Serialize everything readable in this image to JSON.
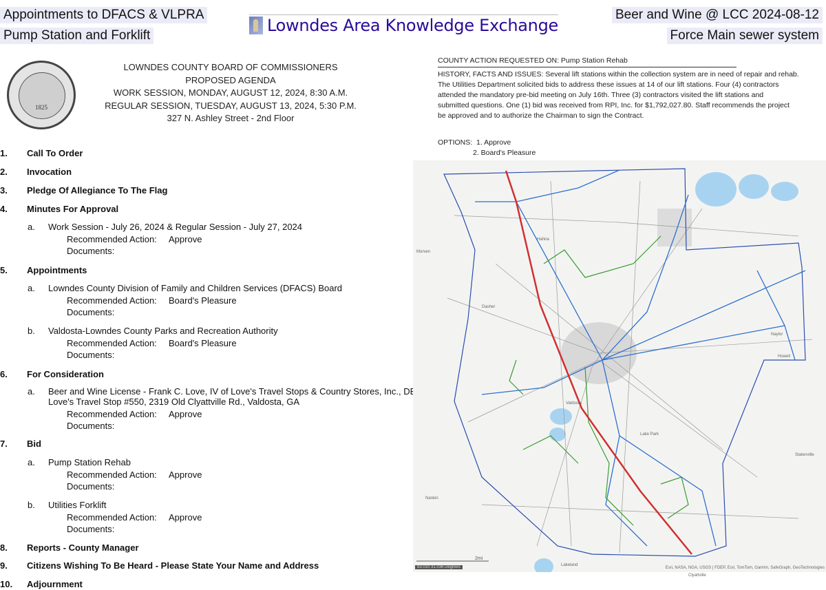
{
  "tags": {
    "top_left_1": "Appointments to DFACS & VLPRA",
    "top_left_2": "Pump Station and Forklift",
    "top_right_1": "Beer and Wine @ LCC 2024-08-12",
    "top_right_2": "Force Main sewer system"
  },
  "brand": {
    "title": "Lowndes Area Knowledge Exchange"
  },
  "seal": {
    "text": "LOWNDES COUNTY, GEORGIA BOARD of COMMISSIONERS 1825",
    "year": "1825"
  },
  "header": {
    "lines": [
      "LOWNDES COUNTY BOARD OF COMMISSIONERS",
      "PROPOSED AGENDA",
      "WORK SESSION, MONDAY, AUGUST 12, 2024, 8:30 A.M.",
      "REGULAR SESSION, TUESDAY, AUGUST 13, 2024, 5:30 P.M.",
      "327 N. Ashley Street - 2nd Floor"
    ]
  },
  "labels": {
    "rec": "Recommended Action:",
    "docs": "Documents:"
  },
  "agenda": [
    {
      "num": "1.",
      "title": "Call To Order"
    },
    {
      "num": "2.",
      "title": "Invocation"
    },
    {
      "num": "3.",
      "title": "Pledge Of Allegiance To The Flag"
    },
    {
      "num": "4.",
      "title": "Minutes For Approval",
      "items": [
        {
          "letter": "a.",
          "text": "Work Session - July 26, 2024 & Regular Session - July 27, 2024",
          "action": "Approve"
        }
      ]
    },
    {
      "num": "5.",
      "title": "Appointments",
      "items": [
        {
          "letter": "a.",
          "text": "Lowndes County Division of Family and Children Services (DFACS) Board",
          "action": "Board's Pleasure"
        },
        {
          "letter": "b.",
          "text": "Valdosta-Lowndes County Parks and Recreation Authority",
          "action": "Board's Pleasure"
        }
      ]
    },
    {
      "num": "6.",
      "title": "For Consideration",
      "items": [
        {
          "letter": "a.",
          "text": "Beer and Wine License - Frank C. Love, IV of Love's Travel Stops & Country Stores, Inc., DBA",
          "text2": "Love's Travel Stop #550, 2319 Old Clyattville Rd., Valdosta, GA",
          "action": "Approve"
        }
      ]
    },
    {
      "num": "7.",
      "title": "Bid",
      "items": [
        {
          "letter": "a.",
          "text": "Pump Station Rehab",
          "action": "Approve"
        },
        {
          "letter": "b.",
          "text": "Utilities Forklift",
          "action": "Approve"
        }
      ]
    },
    {
      "num": "8.",
      "title": "Reports - County Manager"
    },
    {
      "num": "9.",
      "title": "Citizens Wishing To Be Heard - Please State Your Name and Address"
    },
    {
      "num": "10.",
      "title": "Adjournment"
    }
  ],
  "action_request": {
    "title": "COUNTY ACTION REQUESTED ON: Pump Station Rehab",
    "history": [
      "HISTORY, FACTS AND ISSUES: Several lift stations within the collection system are in need of repair and rehab.",
      "The Utilities Department solicited bids to address these issues at 14 of our lift stations. Four (4) contractors",
      "attended the mandatory pre-bid meeting on July 16th. Three (3) contractors visited the lift stations and",
      "submitted questions. One (1) bid was received from RPI, Inc. for $1,792,027.80. Staff recommends the project",
      "be approved and to authorize the Chairman to sign the Contract."
    ],
    "options_label": "OPTIONS:",
    "options": [
      "1. Approve",
      "2. Board's Pleasure"
    ]
  },
  "map": {
    "scale": "2mi",
    "coords": "83.010 31.036 Degrees",
    "attribution": "Esri, NASA, NGA, USGS | FDEP, Esri, TomTom, Garmin, SafeGraph, GeoTechnologies",
    "place_labels": [
      "Morven",
      "Dasher",
      "Hahira",
      "Valdosta",
      "Lake Park",
      "Clyattville",
      "Naylor",
      "Howell",
      "Statenville",
      "Lakeland",
      "Nankin"
    ],
    "colors": {
      "boundary": "#2b4bb0",
      "interstate": "#d03030",
      "force_main": "#2e6fd0",
      "green_lines": "#3a9a30",
      "water": "#a8d3f0"
    }
  }
}
